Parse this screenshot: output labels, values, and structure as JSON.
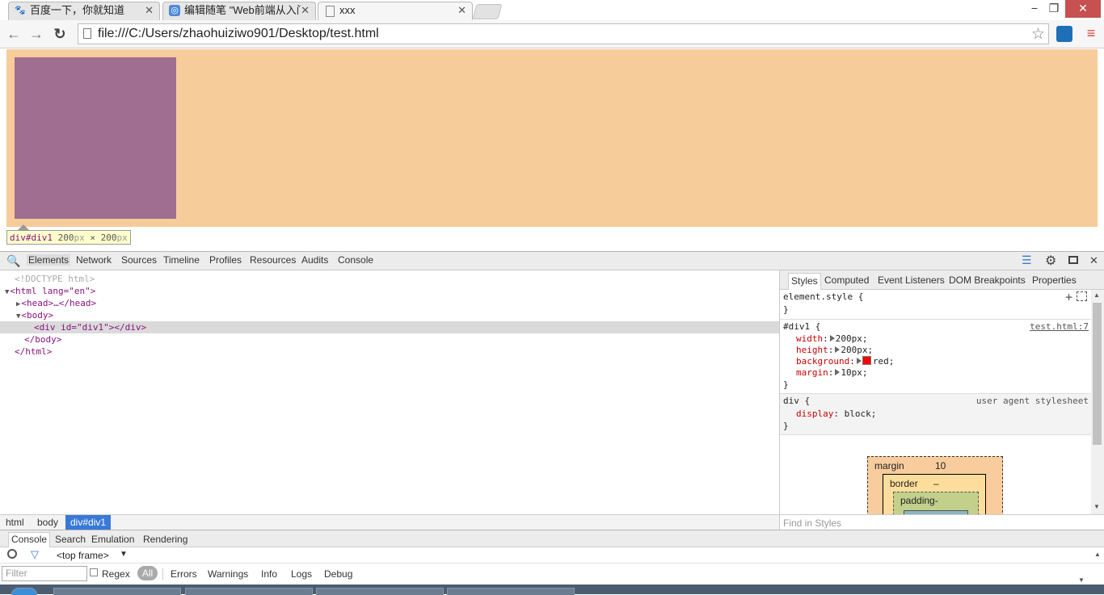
{
  "tabs": [
    {
      "title": "百度一下，你就知道",
      "icon": "paw-icon"
    },
    {
      "title": "编辑随笔 \"Web前端从入门",
      "icon": "blog-icon"
    },
    {
      "title": "xxx",
      "icon": "page-icon"
    }
  ],
  "window": {
    "minimize": "−",
    "restore": "❐",
    "close": "✕"
  },
  "omnibox": {
    "url": "file:///C:/Users/zhaohuiziwo901/Desktop/test.html"
  },
  "page": {
    "tooltip_tag": "div#div1",
    "tooltip_w": "200",
    "tooltip_h": "200",
    "tooltip_unit": "px",
    "tooltip_x": "×"
  },
  "devtools": {
    "tabs": [
      "Elements",
      "Network",
      "Sources",
      "Timeline",
      "Profiles",
      "Resources",
      "Audits",
      "Console"
    ],
    "dom_lines": [
      "<!DOCTYPE html>",
      "<html lang=\"en\">",
      "<head>…</head>",
      "<body>",
      "<div id=\"div1\"></div>",
      "</body>",
      "</html>"
    ],
    "breadcrumbs": [
      "html",
      "body",
      "div#div1"
    ],
    "styles_tabs": [
      "Styles",
      "Computed",
      "Event Listeners",
      "DOM Breakpoints",
      "Properties"
    ],
    "element_style": "element.style {",
    "close_brace": "}",
    "rule1": {
      "selector": "#div1 {",
      "source": "test.html:7",
      "props": [
        {
          "name": "width",
          "value": "200px;"
        },
        {
          "name": "height",
          "value": "200px;"
        },
        {
          "name": "background",
          "value": "red;"
        },
        {
          "name": "margin",
          "value": "10px;"
        }
      ]
    },
    "rule2": {
      "selector": "div {",
      "source": "user agent stylesheet",
      "prop_name": "display",
      "prop_value": "block;"
    },
    "boxmodel": {
      "margin_label": "margin",
      "margin_value": "10",
      "border_label": "border",
      "border_value": "–",
      "padding_label": "padding-"
    },
    "find_placeholder": "Find in Styles"
  },
  "drawer": {
    "tabs": [
      "Console",
      "Search",
      "Emulation",
      "Rendering"
    ],
    "frame": "<top frame>",
    "filter_placeholder": "Filter",
    "regex": "Regex",
    "all": "All",
    "levels": [
      "Errors",
      "Warnings",
      "Info",
      "Logs",
      "Debug"
    ]
  },
  "colors": {
    "body_highlight": "#f7cc9b",
    "div_highlight": "#a06e90",
    "selected_crumb": "#3879d9"
  }
}
